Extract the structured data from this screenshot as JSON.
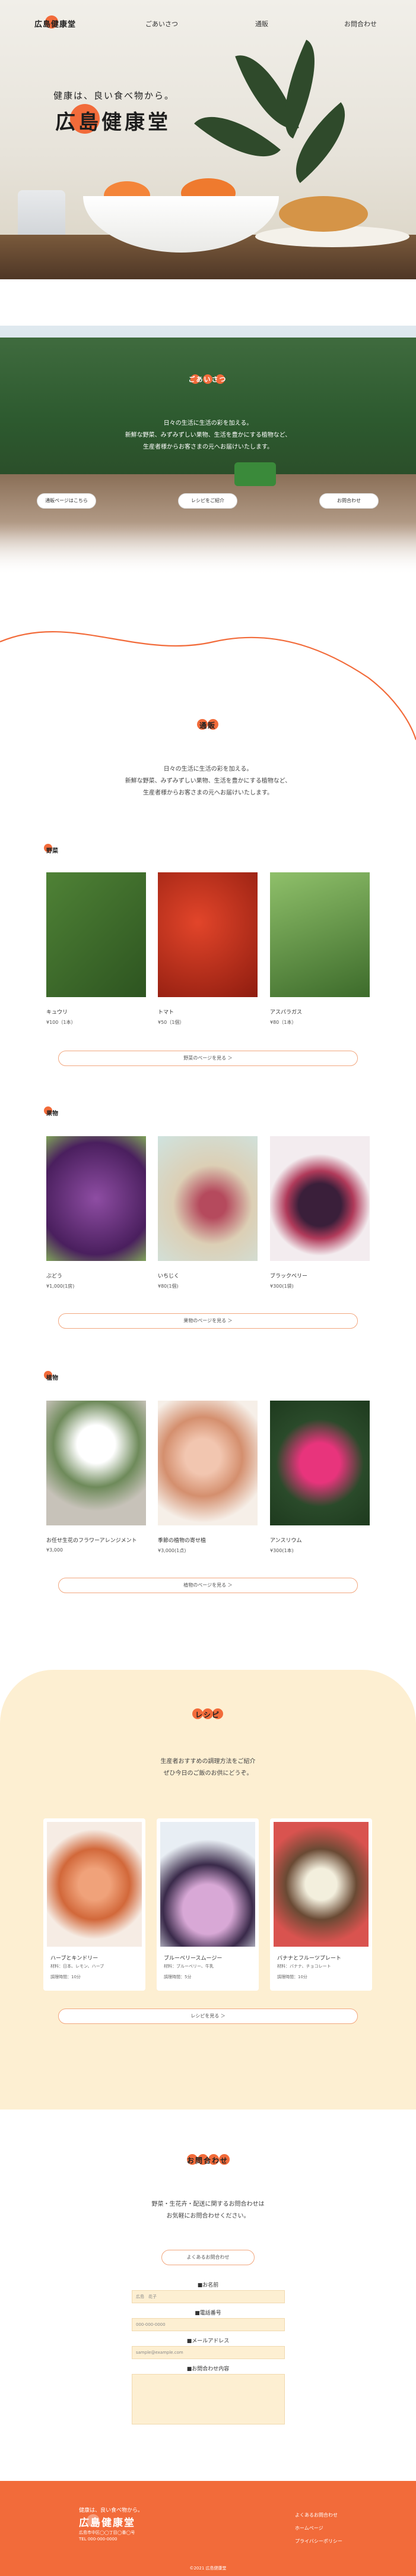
{
  "header": {
    "logo": "広島健康堂",
    "nav": [
      "ごあいさつ",
      "通販",
      "お問合わせ"
    ]
  },
  "hero": {
    "tagline": "健康は、良い食べ物から。",
    "brand": "広島健康堂"
  },
  "greeting": {
    "title": "ごあいさつ",
    "lines": [
      "日々の生活に生活の彩を加える。",
      "新鮮な野菜、みずみずしい果物、生活を豊かにする植物など、",
      "生産者様からお客さまの元へお届けいたします。"
    ],
    "buttons": [
      "通販ページはこちら",
      "レシピをご紹介",
      "お問合わせ"
    ]
  },
  "shop": {
    "title": "通販",
    "lines": [
      "日々の生活に生活の彩を加える。",
      "新鮮な野菜、みずみずしい果物、生活を豊かにする植物など、",
      "生産者様からお客さまの元へお届けいたします。"
    ],
    "categories": [
      {
        "label": "野菜",
        "items": [
          {
            "name": "キュウリ",
            "price": "¥100（1本）",
            "colors": [
              "#3f6d2b",
              "#2d5420"
            ]
          },
          {
            "name": "トマト",
            "price": "¥50（1個）",
            "colors": [
              "#d23a1e",
              "#8e1c0f"
            ]
          },
          {
            "name": "アスパラガス",
            "price": "¥80（1本）",
            "colors": [
              "#6ea04a",
              "#3d6b2b"
            ]
          }
        ],
        "more": "野菜のページを見る ＞"
      },
      {
        "label": "果物",
        "items": [
          {
            "name": "ぶどう",
            "price": "¥1,000(1房)",
            "colors": [
              "#7a3b8f",
              "#4a1f5e"
            ]
          },
          {
            "name": "いちじく",
            "price": "¥80(1個)",
            "colors": [
              "#eacdb0",
              "#8f3b4e"
            ]
          },
          {
            "name": "ブラックベリー",
            "price": "¥300(1袋)",
            "colors": [
              "#f2ebef",
              "#3a1f3a"
            ]
          }
        ],
        "more": "果物のページを見る ＞"
      },
      {
        "label": "植物",
        "items": [
          {
            "name": "お任せ生花のフラワーアレンジメント",
            "price": "¥3,000",
            "colors": [
              "#c7c2b9",
              "#5a5a58"
            ]
          },
          {
            "name": "季節の植物の寄せ植",
            "price": "¥3,000(1点)",
            "colors": [
              "#e7b8a4",
              "#b05a3e"
            ]
          },
          {
            "name": "アンスリウム",
            "price": "¥300(1本)",
            "colors": [
              "#d12c6e",
              "#2a4a2a"
            ]
          }
        ],
        "more": "植物のページを見る ＞"
      }
    ]
  },
  "recipe": {
    "title": "レシピ",
    "lines": [
      "生産者おすすめの調理方法をご紹介",
      "ぜひ今日のご飯のお供にどうぞ。"
    ],
    "cards": [
      {
        "name": "ハーブとキンドリー",
        "ing": "材料：日本、レモン、ハーブ",
        "time": "調理時間：10分",
        "colors": [
          "#f4b08a",
          "#d2683a"
        ]
      },
      {
        "name": "ブルーベリースムージー",
        "ing": "材料：ブルーベリー、牛乳",
        "time": "調理時間：5分",
        "colors": [
          "#d8a8d6",
          "#4a2c5a"
        ]
      },
      {
        "name": "バナナとフルーツプレート",
        "ing": "材料：バナナ、チョコレート",
        "time": "調理時間：10分",
        "colors": [
          "#e9e3cf",
          "#5a4030"
        ]
      }
    ],
    "more": "レシピを見る ＞"
  },
  "contact": {
    "title": "お問合わせ",
    "lines": [
      "野菜・生花卉・配送に関するお問合わせは",
      "お気軽にお問合わせください。"
    ],
    "faq": "よくあるお問合わせ",
    "fields": [
      {
        "label": "■お名前",
        "placeholder": "広島　花子"
      },
      {
        "label": "■電話番号",
        "placeholder": "000-000-0000"
      },
      {
        "label": "■メールアドレス",
        "placeholder": "sample@example.com"
      },
      {
        "label": "■お問合わせ内容",
        "placeholder": ""
      }
    ]
  },
  "footer": {
    "tag": "健康は、良い食べ物から。",
    "brand": "広島健康堂",
    "address": [
      "広島市中区◯◯丁目◯番◯号",
      "TEL 000-000-0000"
    ],
    "links": [
      "よくあるお問合わせ",
      "ホームページ",
      "プライバシーポリシー"
    ],
    "copy": "©2021 広島健康堂"
  }
}
